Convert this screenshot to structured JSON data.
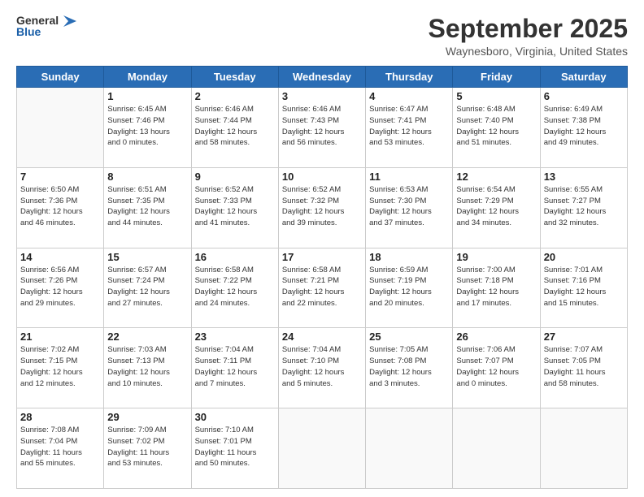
{
  "header": {
    "logo_line1": "General",
    "logo_line2": "Blue",
    "month": "September 2025",
    "location": "Waynesboro, Virginia, United States"
  },
  "weekdays": [
    "Sunday",
    "Monday",
    "Tuesday",
    "Wednesday",
    "Thursday",
    "Friday",
    "Saturday"
  ],
  "weeks": [
    [
      {
        "day": null,
        "info": null
      },
      {
        "day": "1",
        "info": "Sunrise: 6:45 AM\nSunset: 7:46 PM\nDaylight: 13 hours\nand 0 minutes."
      },
      {
        "day": "2",
        "info": "Sunrise: 6:46 AM\nSunset: 7:44 PM\nDaylight: 12 hours\nand 58 minutes."
      },
      {
        "day": "3",
        "info": "Sunrise: 6:46 AM\nSunset: 7:43 PM\nDaylight: 12 hours\nand 56 minutes."
      },
      {
        "day": "4",
        "info": "Sunrise: 6:47 AM\nSunset: 7:41 PM\nDaylight: 12 hours\nand 53 minutes."
      },
      {
        "day": "5",
        "info": "Sunrise: 6:48 AM\nSunset: 7:40 PM\nDaylight: 12 hours\nand 51 minutes."
      },
      {
        "day": "6",
        "info": "Sunrise: 6:49 AM\nSunset: 7:38 PM\nDaylight: 12 hours\nand 49 minutes."
      }
    ],
    [
      {
        "day": "7",
        "info": "Sunrise: 6:50 AM\nSunset: 7:36 PM\nDaylight: 12 hours\nand 46 minutes."
      },
      {
        "day": "8",
        "info": "Sunrise: 6:51 AM\nSunset: 7:35 PM\nDaylight: 12 hours\nand 44 minutes."
      },
      {
        "day": "9",
        "info": "Sunrise: 6:52 AM\nSunset: 7:33 PM\nDaylight: 12 hours\nand 41 minutes."
      },
      {
        "day": "10",
        "info": "Sunrise: 6:52 AM\nSunset: 7:32 PM\nDaylight: 12 hours\nand 39 minutes."
      },
      {
        "day": "11",
        "info": "Sunrise: 6:53 AM\nSunset: 7:30 PM\nDaylight: 12 hours\nand 37 minutes."
      },
      {
        "day": "12",
        "info": "Sunrise: 6:54 AM\nSunset: 7:29 PM\nDaylight: 12 hours\nand 34 minutes."
      },
      {
        "day": "13",
        "info": "Sunrise: 6:55 AM\nSunset: 7:27 PM\nDaylight: 12 hours\nand 32 minutes."
      }
    ],
    [
      {
        "day": "14",
        "info": "Sunrise: 6:56 AM\nSunset: 7:26 PM\nDaylight: 12 hours\nand 29 minutes."
      },
      {
        "day": "15",
        "info": "Sunrise: 6:57 AM\nSunset: 7:24 PM\nDaylight: 12 hours\nand 27 minutes."
      },
      {
        "day": "16",
        "info": "Sunrise: 6:58 AM\nSunset: 7:22 PM\nDaylight: 12 hours\nand 24 minutes."
      },
      {
        "day": "17",
        "info": "Sunrise: 6:58 AM\nSunset: 7:21 PM\nDaylight: 12 hours\nand 22 minutes."
      },
      {
        "day": "18",
        "info": "Sunrise: 6:59 AM\nSunset: 7:19 PM\nDaylight: 12 hours\nand 20 minutes."
      },
      {
        "day": "19",
        "info": "Sunrise: 7:00 AM\nSunset: 7:18 PM\nDaylight: 12 hours\nand 17 minutes."
      },
      {
        "day": "20",
        "info": "Sunrise: 7:01 AM\nSunset: 7:16 PM\nDaylight: 12 hours\nand 15 minutes."
      }
    ],
    [
      {
        "day": "21",
        "info": "Sunrise: 7:02 AM\nSunset: 7:15 PM\nDaylight: 12 hours\nand 12 minutes."
      },
      {
        "day": "22",
        "info": "Sunrise: 7:03 AM\nSunset: 7:13 PM\nDaylight: 12 hours\nand 10 minutes."
      },
      {
        "day": "23",
        "info": "Sunrise: 7:04 AM\nSunset: 7:11 PM\nDaylight: 12 hours\nand 7 minutes."
      },
      {
        "day": "24",
        "info": "Sunrise: 7:04 AM\nSunset: 7:10 PM\nDaylight: 12 hours\nand 5 minutes."
      },
      {
        "day": "25",
        "info": "Sunrise: 7:05 AM\nSunset: 7:08 PM\nDaylight: 12 hours\nand 3 minutes."
      },
      {
        "day": "26",
        "info": "Sunrise: 7:06 AM\nSunset: 7:07 PM\nDaylight: 12 hours\nand 0 minutes."
      },
      {
        "day": "27",
        "info": "Sunrise: 7:07 AM\nSunset: 7:05 PM\nDaylight: 11 hours\nand 58 minutes."
      }
    ],
    [
      {
        "day": "28",
        "info": "Sunrise: 7:08 AM\nSunset: 7:04 PM\nDaylight: 11 hours\nand 55 minutes."
      },
      {
        "day": "29",
        "info": "Sunrise: 7:09 AM\nSunset: 7:02 PM\nDaylight: 11 hours\nand 53 minutes."
      },
      {
        "day": "30",
        "info": "Sunrise: 7:10 AM\nSunset: 7:01 PM\nDaylight: 11 hours\nand 50 minutes."
      },
      {
        "day": null,
        "info": null
      },
      {
        "day": null,
        "info": null
      },
      {
        "day": null,
        "info": null
      },
      {
        "day": null,
        "info": null
      }
    ]
  ]
}
